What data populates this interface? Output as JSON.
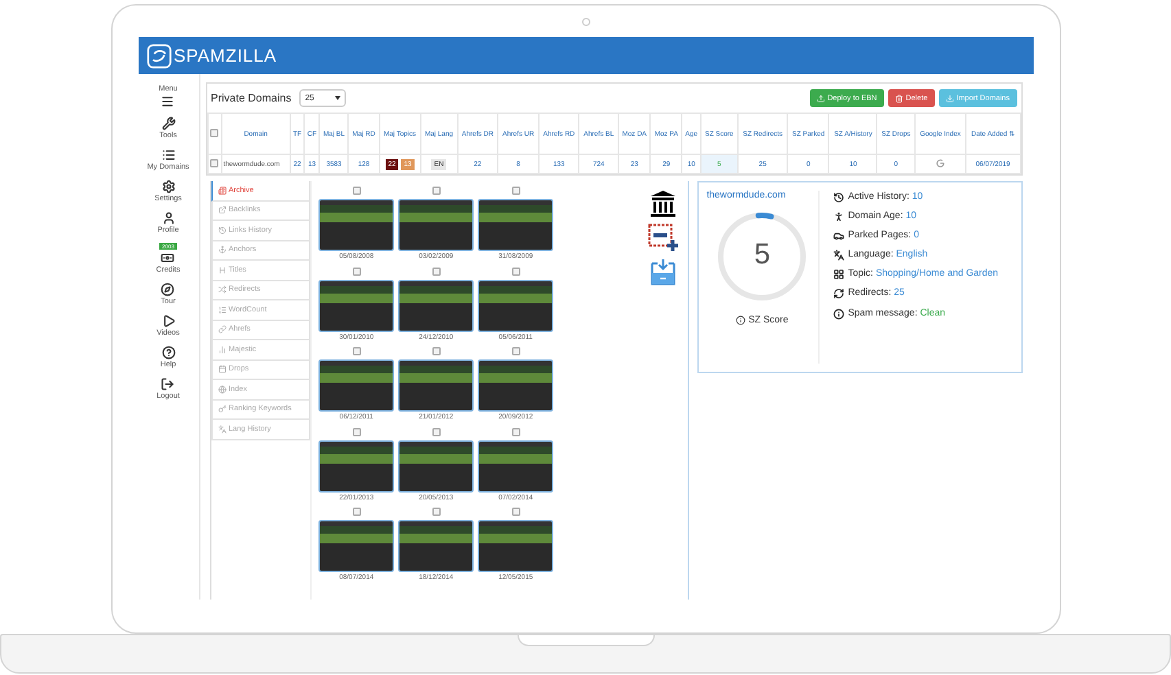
{
  "header": {
    "logo_text": "SPAMZILLA"
  },
  "sidebar": {
    "items": [
      {
        "label": "Menu"
      },
      {
        "label": "Tools"
      },
      {
        "label": "My Domains"
      },
      {
        "label": "Settings"
      },
      {
        "label": "Profile"
      },
      {
        "label": "Credits",
        "badge": "2003"
      },
      {
        "label": "Tour"
      },
      {
        "label": "Videos"
      },
      {
        "label": "Help"
      },
      {
        "label": "Logout"
      }
    ]
  },
  "toolbar": {
    "title": "Private Domains",
    "page_size": "25",
    "buttons": [
      {
        "label": "Deploy to EBN",
        "kind": "success"
      },
      {
        "label": "Delete",
        "kind": "danger"
      },
      {
        "label": "Import Domains",
        "kind": "info"
      }
    ]
  },
  "table": {
    "select_all_checked": false,
    "columns": [
      "Domain",
      "TF",
      "CF",
      "Maj BL",
      "Maj RD",
      "Maj Topics",
      "Maj Lang",
      "Ahrefs DR",
      "Ahrefs UR",
      "Ahrefs RD",
      "Ahrefs BL",
      "Moz DA",
      "Moz PA",
      "Age",
      "SZ Score",
      "SZ Redirects",
      "SZ Parked",
      "SZ A/History",
      "SZ Drops",
      "Google Index",
      "Date Added ⇅"
    ],
    "rows": [
      {
        "checked": false,
        "domain": "thewormdude.com",
        "tf": "22",
        "cf": "13",
        "maj_bl": "3583",
        "maj_rd": "128",
        "topics": [
          {
            "label": "22",
            "color": "#6b0f0f"
          },
          {
            "label": "13",
            "color": "#e0975a"
          }
        ],
        "lang": "EN",
        "ahrefs_dr": "22",
        "ahrefs_ur": "8",
        "ahrefs_rd": "133",
        "ahrefs_bl": "724",
        "moz_da": "23",
        "moz_pa": "29",
        "age": "10",
        "sz_score": "5",
        "sz_redirects": "25",
        "sz_parked": "0",
        "sz_history": "10",
        "sz_drops": "0",
        "date_added": "06/07/2019"
      }
    ]
  },
  "tabs": [
    {
      "label": "Archive",
      "selected": true
    },
    {
      "label": "Backlinks",
      "selected": false
    },
    {
      "label": "Links History",
      "selected": false
    },
    {
      "label": "Anchors",
      "selected": false
    },
    {
      "label": "Titles",
      "selected": false
    },
    {
      "label": "Redirects",
      "selected": false
    },
    {
      "label": "WordCount",
      "selected": false
    },
    {
      "label": "Ahrefs",
      "selected": false
    },
    {
      "label": "Majestic",
      "selected": false
    },
    {
      "label": "Drops",
      "selected": false
    },
    {
      "label": "Index",
      "selected": false
    },
    {
      "label": "Ranking Keywords",
      "selected": false
    },
    {
      "label": "Lang History",
      "selected": false
    }
  ],
  "snapshots": [
    {
      "date": "05/08/2008",
      "checked": false
    },
    {
      "date": "03/02/2009",
      "checked": false
    },
    {
      "date": "31/08/2009",
      "checked": false
    },
    {
      "date": "30/01/2010",
      "checked": false
    },
    {
      "date": "24/12/2010",
      "checked": false
    },
    {
      "date": "05/06/2011",
      "checked": false
    },
    {
      "date": "06/12/2011",
      "checked": false
    },
    {
      "date": "21/01/2012",
      "checked": false
    },
    {
      "date": "20/09/2012",
      "checked": false
    },
    {
      "date": "22/01/2013",
      "checked": false
    },
    {
      "date": "20/05/2013",
      "checked": false
    },
    {
      "date": "07/02/2014",
      "checked": false
    },
    {
      "date": "08/07/2014",
      "checked": false
    },
    {
      "date": "18/12/2014",
      "checked": false
    },
    {
      "date": "12/05/2015",
      "checked": false
    }
  ],
  "summary": {
    "domain": "thewormdude.com",
    "score": "5",
    "level": 0.05,
    "score_label": "SZ Score",
    "facts": [
      {
        "label": "Active History:",
        "value": "10",
        "kind": "link"
      },
      {
        "label": "Domain Age:",
        "value": "10",
        "kind": "link"
      },
      {
        "label": "Parked Pages:",
        "value": "0",
        "kind": "link"
      },
      {
        "label": "Language:",
        "value": "English",
        "kind": "link"
      },
      {
        "label": "Topic:",
        "value": "Shopping/Home and Garden",
        "kind": "link"
      },
      {
        "label": "Redirects:",
        "value": "25",
        "kind": "link"
      },
      {
        "label": "Spam message:",
        "value": "Clean",
        "kind": "good"
      }
    ]
  }
}
